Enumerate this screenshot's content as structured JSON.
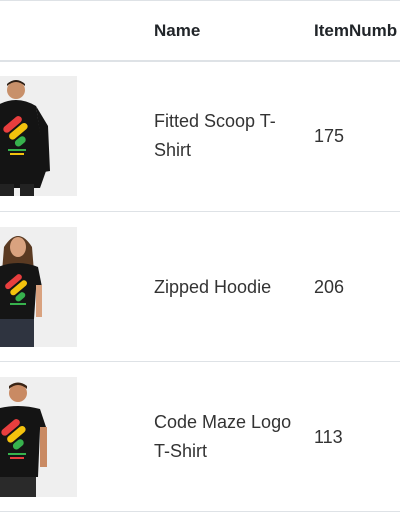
{
  "table": {
    "columns": [
      "",
      "Name",
      "ItemNumb"
    ],
    "rows": [
      {
        "image": "hooded-jacket-photo",
        "name": "Fitted Scoop T-Shirt",
        "item_number": "175"
      },
      {
        "image": "woman-tshirt-photo",
        "name": "Zipped Hoodie",
        "item_number": "206"
      },
      {
        "image": "man-tshirt-photo",
        "name": "Code Maze Logo T-Shirt",
        "item_number": "113"
      }
    ]
  },
  "colors": {
    "divider": "#dee2e6",
    "shirt": "#111111",
    "logo_red": "#e83e3e",
    "logo_yellow": "#f4c20d",
    "logo_green": "#37b24d"
  }
}
